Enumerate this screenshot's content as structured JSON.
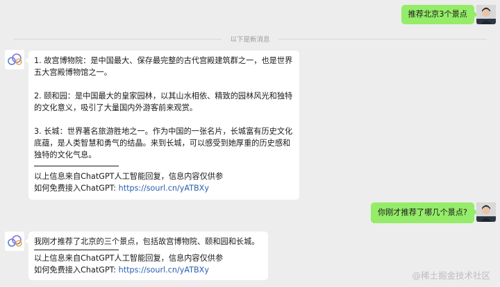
{
  "messages": {
    "m1": {
      "text": "推荐北京3个景点"
    },
    "divider": {
      "text": "以下是新消息"
    },
    "m2": {
      "p1": "1. 故宫博物院：是中国最大、保存最完整的古代宫殿建筑群之一，也是世界五大宫殿博物馆之一。",
      "p2": "2. 颐和园：是中国最大的皇家园林，以其山水相依、精致的园林风光和独特的文化意义，吸引了大量国内外游客前来观赏。",
      "p3": "3. 长城：世界著名旅游胜地之一。作为中国的一张名片，长城富有历史文化底蕴，是人类智慧和勇气的结晶。来到长城，可以感受到她厚重的历史感和独特的文化气息。",
      "footer1": "以上信息来自ChatGPT人工智能回复，信息内容仅供参",
      "footer2_prefix": "如何免费接入ChatGPT: ",
      "footer2_link": "https://sourl.cn/yATBXy"
    },
    "m3": {
      "text": "你刚才推荐了哪几个景点?"
    },
    "m4": {
      "p1": "我刚才推荐了北京的三个景点，包括故宫博物院、颐和园和长城。",
      "footer1": "以上信息来自ChatGPT人工智能回复，信息内容仅供参",
      "footer2_prefix": "如何免费接入ChatGPT: ",
      "footer2_link": "https://sourl.cn/yATBXy"
    }
  },
  "watermark": {
    "text": "@稀土掘金技术社区"
  }
}
